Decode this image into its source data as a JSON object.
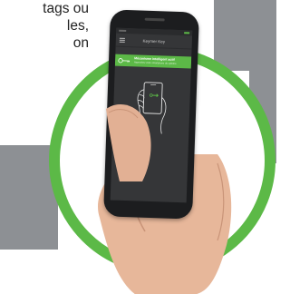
{
  "marketing_text": {
    "lines": [
      "tags ou",
      "les,",
      "on"
    ]
  },
  "phone": {
    "app_title": "Keymer Key",
    "banner": {
      "title": "Mécanisme intelligent actif",
      "subtitle": "Approchez votre smartphone du cylindre"
    }
  },
  "colors": {
    "accent_green": "#5cb947",
    "panel_grey": "#8d9094",
    "screen_dark": "#353638"
  },
  "icons": {
    "menu": "hamburger-menu-icon",
    "key": "key-icon",
    "illustration": "phone-in-hand-icon"
  }
}
